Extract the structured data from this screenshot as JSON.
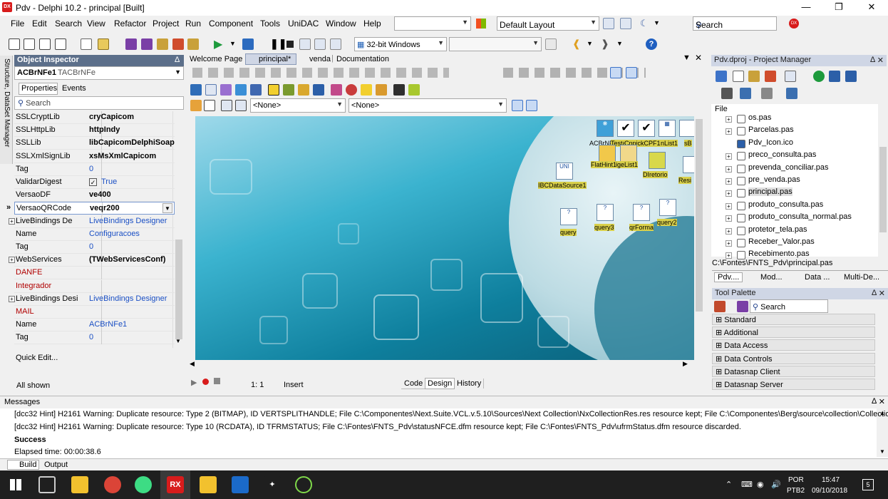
{
  "window": {
    "title": "Pdv - Delphi 10.2 - principal [Built]",
    "logo": "DX"
  },
  "menu": [
    "File",
    "Edit",
    "Search",
    "View",
    "Refactor",
    "Project",
    "Run",
    "Component",
    "Tools",
    "UniDAC",
    "Window",
    "Help"
  ],
  "toolbar": {
    "layout_value": "Default Layout",
    "search_placeholder": "Search",
    "platform": "32-bit Windows"
  },
  "object_inspector": {
    "title": "Object Inspector",
    "selected_object": "ACBrNFe1",
    "selected_type": "TACBrNFe",
    "tabs": [
      "Properties",
      "Events"
    ],
    "search_placeholder": "Search",
    "rows": [
      {
        "k": "SSLCryptLib",
        "v": "cryCapicom",
        "bold": true
      },
      {
        "k": "SSLHttpLib",
        "v": "httpIndy",
        "bold": true
      },
      {
        "k": "SSLLib",
        "v": "libCapicomDelphiSoap",
        "bold": true
      },
      {
        "k": "SSLXmlSignLib",
        "v": "xsMsXmlCapicom",
        "bold": true
      },
      {
        "k": "Tag",
        "v": "0",
        "color": "#1a4fc4"
      },
      {
        "k": "ValidarDigest",
        "v": "True",
        "color": "#1a4fc4"
      },
      {
        "k": "VersaoDF",
        "v": "ve400",
        "bold": true
      },
      {
        "k": "VersaoQRCode",
        "v": "veqr200",
        "bold": true
      },
      {
        "k": "LiveBindings De",
        "v": "LiveBindings Designer",
        "color": "#1a4fc4"
      },
      {
        "k": "Name",
        "v": "Configuracoes",
        "color": "#1a4fc4"
      },
      {
        "k": "Tag",
        "v": "0",
        "color": "#1a4fc4"
      },
      {
        "k": "WebServices",
        "v": "(TWebServicesConf)",
        "bold": true
      },
      {
        "k": "DANFE",
        "v": "",
        "color": "#b00000"
      },
      {
        "k": "Integrador",
        "v": "",
        "color": "#b00000"
      },
      {
        "k": "LiveBindings Desi",
        "v": "LiveBindings Designer",
        "color": "#1a4fc4"
      },
      {
        "k": "MAIL",
        "v": "",
        "color": "#b00000"
      },
      {
        "k": "Name",
        "v": "ACBrNFe1",
        "color": "#1a4fc4"
      },
      {
        "k": "Tag",
        "v": "0",
        "color": "#1a4fc4"
      }
    ],
    "quick_edit": "Quick Edit...",
    "status": "All shown"
  },
  "side_tab": "Structure, DataSet Manager",
  "editor": {
    "tabs": [
      "Welcome Page",
      "principal*",
      "venda",
      "Documentation"
    ],
    "combo1": "<None>",
    "combo2": "<None>",
    "components": [
      {
        "label": "ACBrNFe1"
      },
      {
        "label": "Testa"
      },
      {
        "label": "CnpjckCPF1"
      },
      {
        "label": "nList1"
      },
      {
        "label": "sB"
      },
      {
        "label": "FlatHint1"
      },
      {
        "label": "igeList1"
      },
      {
        "label": "DIretorio"
      },
      {
        "label": "Resi"
      },
      {
        "label": "IBCDataSource1"
      },
      {
        "label": "query"
      },
      {
        "label": "query3"
      },
      {
        "label": "qrForma"
      },
      {
        "label": "query2"
      }
    ],
    "status": {
      "position": "1:  1",
      "mode": "Insert",
      "tabs": [
        "Code",
        "Design",
        "History"
      ]
    }
  },
  "project_manager": {
    "title": "Pdv.dproj - Project Manager",
    "column": "File",
    "files": [
      "os.pas",
      "Parcelas.pas",
      "Pdv_Icon.ico",
      "preco_consulta.pas",
      "prevenda_conciliar.pas",
      "pre_venda.pas",
      "principal.pas",
      "produto_consulta.pas",
      "produto_consulta_normal.pas",
      "protetor_tela.pas",
      "Receber_Valor.pas",
      "Recebimento.pas"
    ],
    "path": "C:\\Fontes\\FNTS_Pdv\\principal.pas",
    "tabs": [
      "Pdv....",
      "Mod...",
      "Data ...",
      "Multi-De..."
    ]
  },
  "tool_palette": {
    "title": "Tool Palette",
    "search_placeholder": "Search",
    "categories": [
      "Standard",
      "Additional",
      "Data Access",
      "Data Controls",
      "Datasnap Client",
      "Datasnap Server"
    ]
  },
  "messages": {
    "title": "Messages",
    "lines": [
      "[dcc32 Hint] H2161 Warning: Duplicate resource:  Type  2 (BITMAP), ID VERTSPLITHANDLE; File C:\\Componentes\\Next.Suite.VCL.v.5.10\\Sources\\Next Collection\\NxCollectionRes.res resource kept; File C:\\Componentes\\Berg\\source\\collection\\Collectio...",
      "[dcc32 Hint] H2161 Warning: Duplicate resource:  Type 10 (RCDATA), ID TFRMSTATUS; File C:\\Fontes\\FNTS_Pdv\\statusNFCE.dfm resource kept; File C:\\Fontes\\FNTS_Pdv\\ufrmStatus.dfm resource discarded.",
      "Success",
      "Elapsed time: 00:00:38.6"
    ],
    "tabs": [
      "Build",
      "Output"
    ]
  },
  "taskbar": {
    "lang": "POR",
    "layout": "PTB2",
    "time": "15:47",
    "date": "09/10/2018",
    "notifications": "5"
  }
}
